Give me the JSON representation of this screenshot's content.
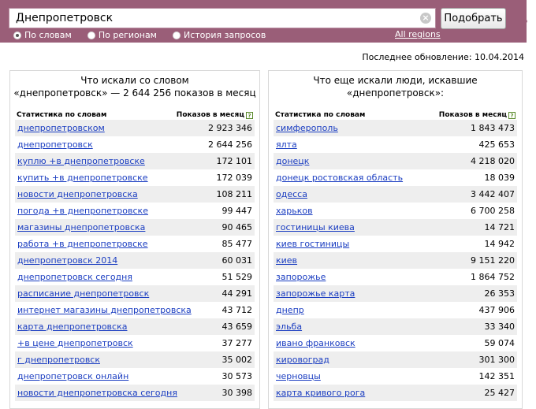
{
  "search": {
    "value": "Днепропетровск",
    "submit_label": "Подобрать",
    "clear_icon": "×"
  },
  "modes": [
    {
      "label": "По словам",
      "checked": true
    },
    {
      "label": "По регионам",
      "checked": false
    },
    {
      "label": "История запросов",
      "checked": false
    }
  ],
  "all_regions": "All regions",
  "updated": "Последнее обновление: 10.04.2014",
  "left_panel": {
    "title_line1": "Что искали со словом",
    "title_line2": "«днепропетровск» — 2 644 256 показов в месяц",
    "col_keyword": "Статистика по словам",
    "col_count": "Показов в месяц",
    "rows": [
      {
        "kw": "днепропетровском",
        "num": "2 923 346"
      },
      {
        "kw": "днепропетровск",
        "num": "2 644 256"
      },
      {
        "kw": "куплю +в днепропетровске",
        "num": "172 101"
      },
      {
        "kw": "купить +в днепропетровске",
        "num": "172 039"
      },
      {
        "kw": "новости днепропетровска",
        "num": "108 211"
      },
      {
        "kw": "погода +в днепропетровске",
        "num": "99 447"
      },
      {
        "kw": "магазины днепропетровска",
        "num": "90 465"
      },
      {
        "kw": "работа +в днепропетровске",
        "num": "85 477"
      },
      {
        "kw": "днепропетровск 2014",
        "num": "60 031"
      },
      {
        "kw": "днепропетровск сегодня",
        "num": "51 529"
      },
      {
        "kw": "расписание днепропетровск",
        "num": "44 291"
      },
      {
        "kw": "интернет магазины днепропетровска",
        "num": "43 712"
      },
      {
        "kw": "карта днепропетровска",
        "num": "43 659"
      },
      {
        "kw": "+в цене днепропетровск",
        "num": "37 277"
      },
      {
        "kw": "г днепропетровск",
        "num": "35 002"
      },
      {
        "kw": "днепропетровск онлайн",
        "num": "30 573"
      },
      {
        "kw": "новости днепропетровска сегодня",
        "num": "30 398"
      }
    ]
  },
  "right_panel": {
    "title_line1": "Что еще искали люди, искавшие",
    "title_line2": "«днепропетровск»:",
    "col_keyword": "Статистика по словам",
    "col_count": "Показов в месяц",
    "rows": [
      {
        "kw": "симферополь",
        "num": "1 843 473"
      },
      {
        "kw": "ялта",
        "num": "425 653"
      },
      {
        "kw": "донецк",
        "num": "4 218 020"
      },
      {
        "kw": "донецк ростовская область",
        "num": "18 039"
      },
      {
        "kw": "одесса",
        "num": "3 442 407"
      },
      {
        "kw": "харьков",
        "num": "6 700 258"
      },
      {
        "kw": "гостиницы киева",
        "num": "14 721"
      },
      {
        "kw": "киев гостиницы",
        "num": "14 942"
      },
      {
        "kw": "киев",
        "num": "9 151 220"
      },
      {
        "kw": "запорожье",
        "num": "1 864 752"
      },
      {
        "kw": "запорожье карта",
        "num": "26 353"
      },
      {
        "kw": "днепр",
        "num": "437 906"
      },
      {
        "kw": "эльба",
        "num": "33 340"
      },
      {
        "kw": "ивано франковск",
        "num": "59 074"
      },
      {
        "kw": "кировоград",
        "num": "301 300"
      },
      {
        "kw": "черновцы",
        "num": "142 351"
      },
      {
        "kw": "карта кривого рога",
        "num": "25 427"
      }
    ]
  },
  "help_glyph": "?"
}
